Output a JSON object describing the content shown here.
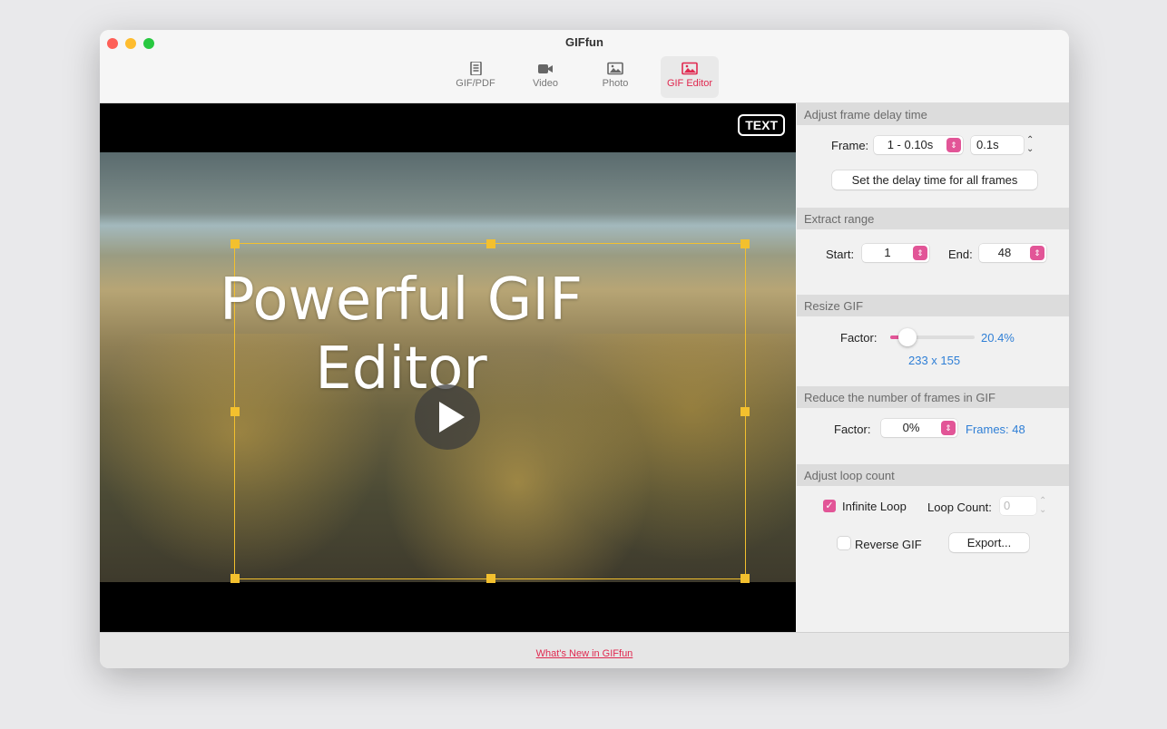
{
  "window": {
    "title": "GIFfun"
  },
  "tabs": [
    {
      "label": "GIF/PDF",
      "icon": "document-icon"
    },
    {
      "label": "Video",
      "icon": "video-camera-icon"
    },
    {
      "label": "Photo",
      "icon": "photo-icon"
    },
    {
      "label": "GIF Editor",
      "icon": "photo-icon",
      "active": true
    }
  ],
  "colors": {
    "accent": "#e0284f",
    "stepper": "#e25597",
    "link_blue": "#2f7fd6",
    "crop": "#f3c02e"
  },
  "preview": {
    "text_button": "TEXT",
    "overlay_text_line1": "Powerful GIF",
    "overlay_text_line2": "Editor"
  },
  "frame_delay": {
    "header": "Adjust frame delay time",
    "frame_label": "Frame:",
    "frame_value": "1 - 0.10s",
    "delay_value": "0.1s",
    "set_all_button": "Set the delay time for all frames"
  },
  "extract": {
    "header": "Extract range",
    "start_label": "Start:",
    "start_value": "1",
    "end_label": "End:",
    "end_value": "48"
  },
  "resize": {
    "header": "Resize GIF",
    "factor_label": "Factor:",
    "factor_value": "20.4%",
    "factor_percent": 20.4,
    "dimensions": "233 x 155"
  },
  "reduce": {
    "header": "Reduce the number of frames in GIF",
    "factor_label": "Factor:",
    "factor_value": "0%",
    "frames": "Frames: 48"
  },
  "loop": {
    "header": "Adjust loop count",
    "infinite_label": "Infinite Loop",
    "infinite_checked": true,
    "count_label": "Loop Count:",
    "count_value": "0",
    "reverse_label": "Reverse GIF",
    "reverse_checked": false,
    "export_button": "Export..."
  },
  "footer": {
    "link": "What's New in GIFfun"
  }
}
